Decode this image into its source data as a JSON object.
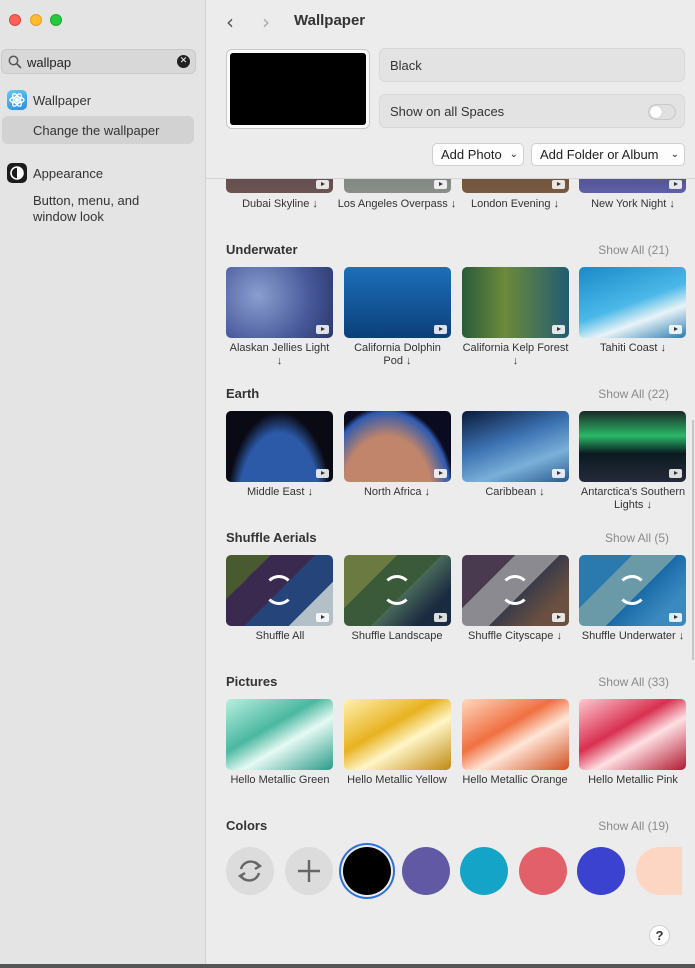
{
  "sidebar": {
    "search": {
      "value": "wallpap"
    },
    "items": [
      {
        "label": "Wallpaper",
        "icon": "wallpaper-icon",
        "sub": "Change the wallpaper"
      },
      {
        "label": "Appearance",
        "icon": "appearance-icon",
        "sub": "Button, menu, and window look"
      }
    ]
  },
  "header": {
    "title": "Wallpaper",
    "back": "‹",
    "forward": "›"
  },
  "current": {
    "name": "Black",
    "show_all_spaces_label": "Show on all Spaces",
    "show_all_spaces": false
  },
  "buttons": {
    "add_photo": "Add Photo",
    "add_folder": "Add Folder or Album"
  },
  "sections": {
    "landscapes_captions": [
      "Dubai Skyline ↓",
      "Los Angeles Overpass ↓",
      "London Evening ↓",
      "New York Night ↓"
    ],
    "underwater": {
      "title": "Underwater",
      "show_all": "Show All (21)",
      "items": [
        "Alaskan Jellies Light ↓",
        "California Dolphin Pod ↓",
        "California Kelp Forest ↓",
        "Tahiti Coast ↓"
      ]
    },
    "earth": {
      "title": "Earth",
      "show_all": "Show All (22)",
      "items": [
        "Middle East ↓",
        "North Africa ↓",
        "Caribbean ↓",
        "Antarctica's Southern Lights ↓"
      ]
    },
    "shuffle": {
      "title": "Shuffle Aerials",
      "show_all": "Show All (5)",
      "items": [
        "Shuffle All",
        "Shuffle Landscape",
        "Shuffle Cityscape ↓",
        "Shuffle Underwater ↓"
      ]
    },
    "pictures": {
      "title": "Pictures",
      "show_all": "Show All (33)",
      "items": [
        "Hello Metallic Green",
        "Hello Metallic Yellow",
        "Hello Metallic Orange",
        "Hello Metallic Pink"
      ]
    },
    "colors": {
      "title": "Colors",
      "show_all": "Show All (19)",
      "swatches": [
        "#000000",
        "#6159a4",
        "#13a4c7",
        "#e1606a",
        "#3b42d0",
        "#fcd6c2"
      ]
    }
  },
  "help_label": "?"
}
